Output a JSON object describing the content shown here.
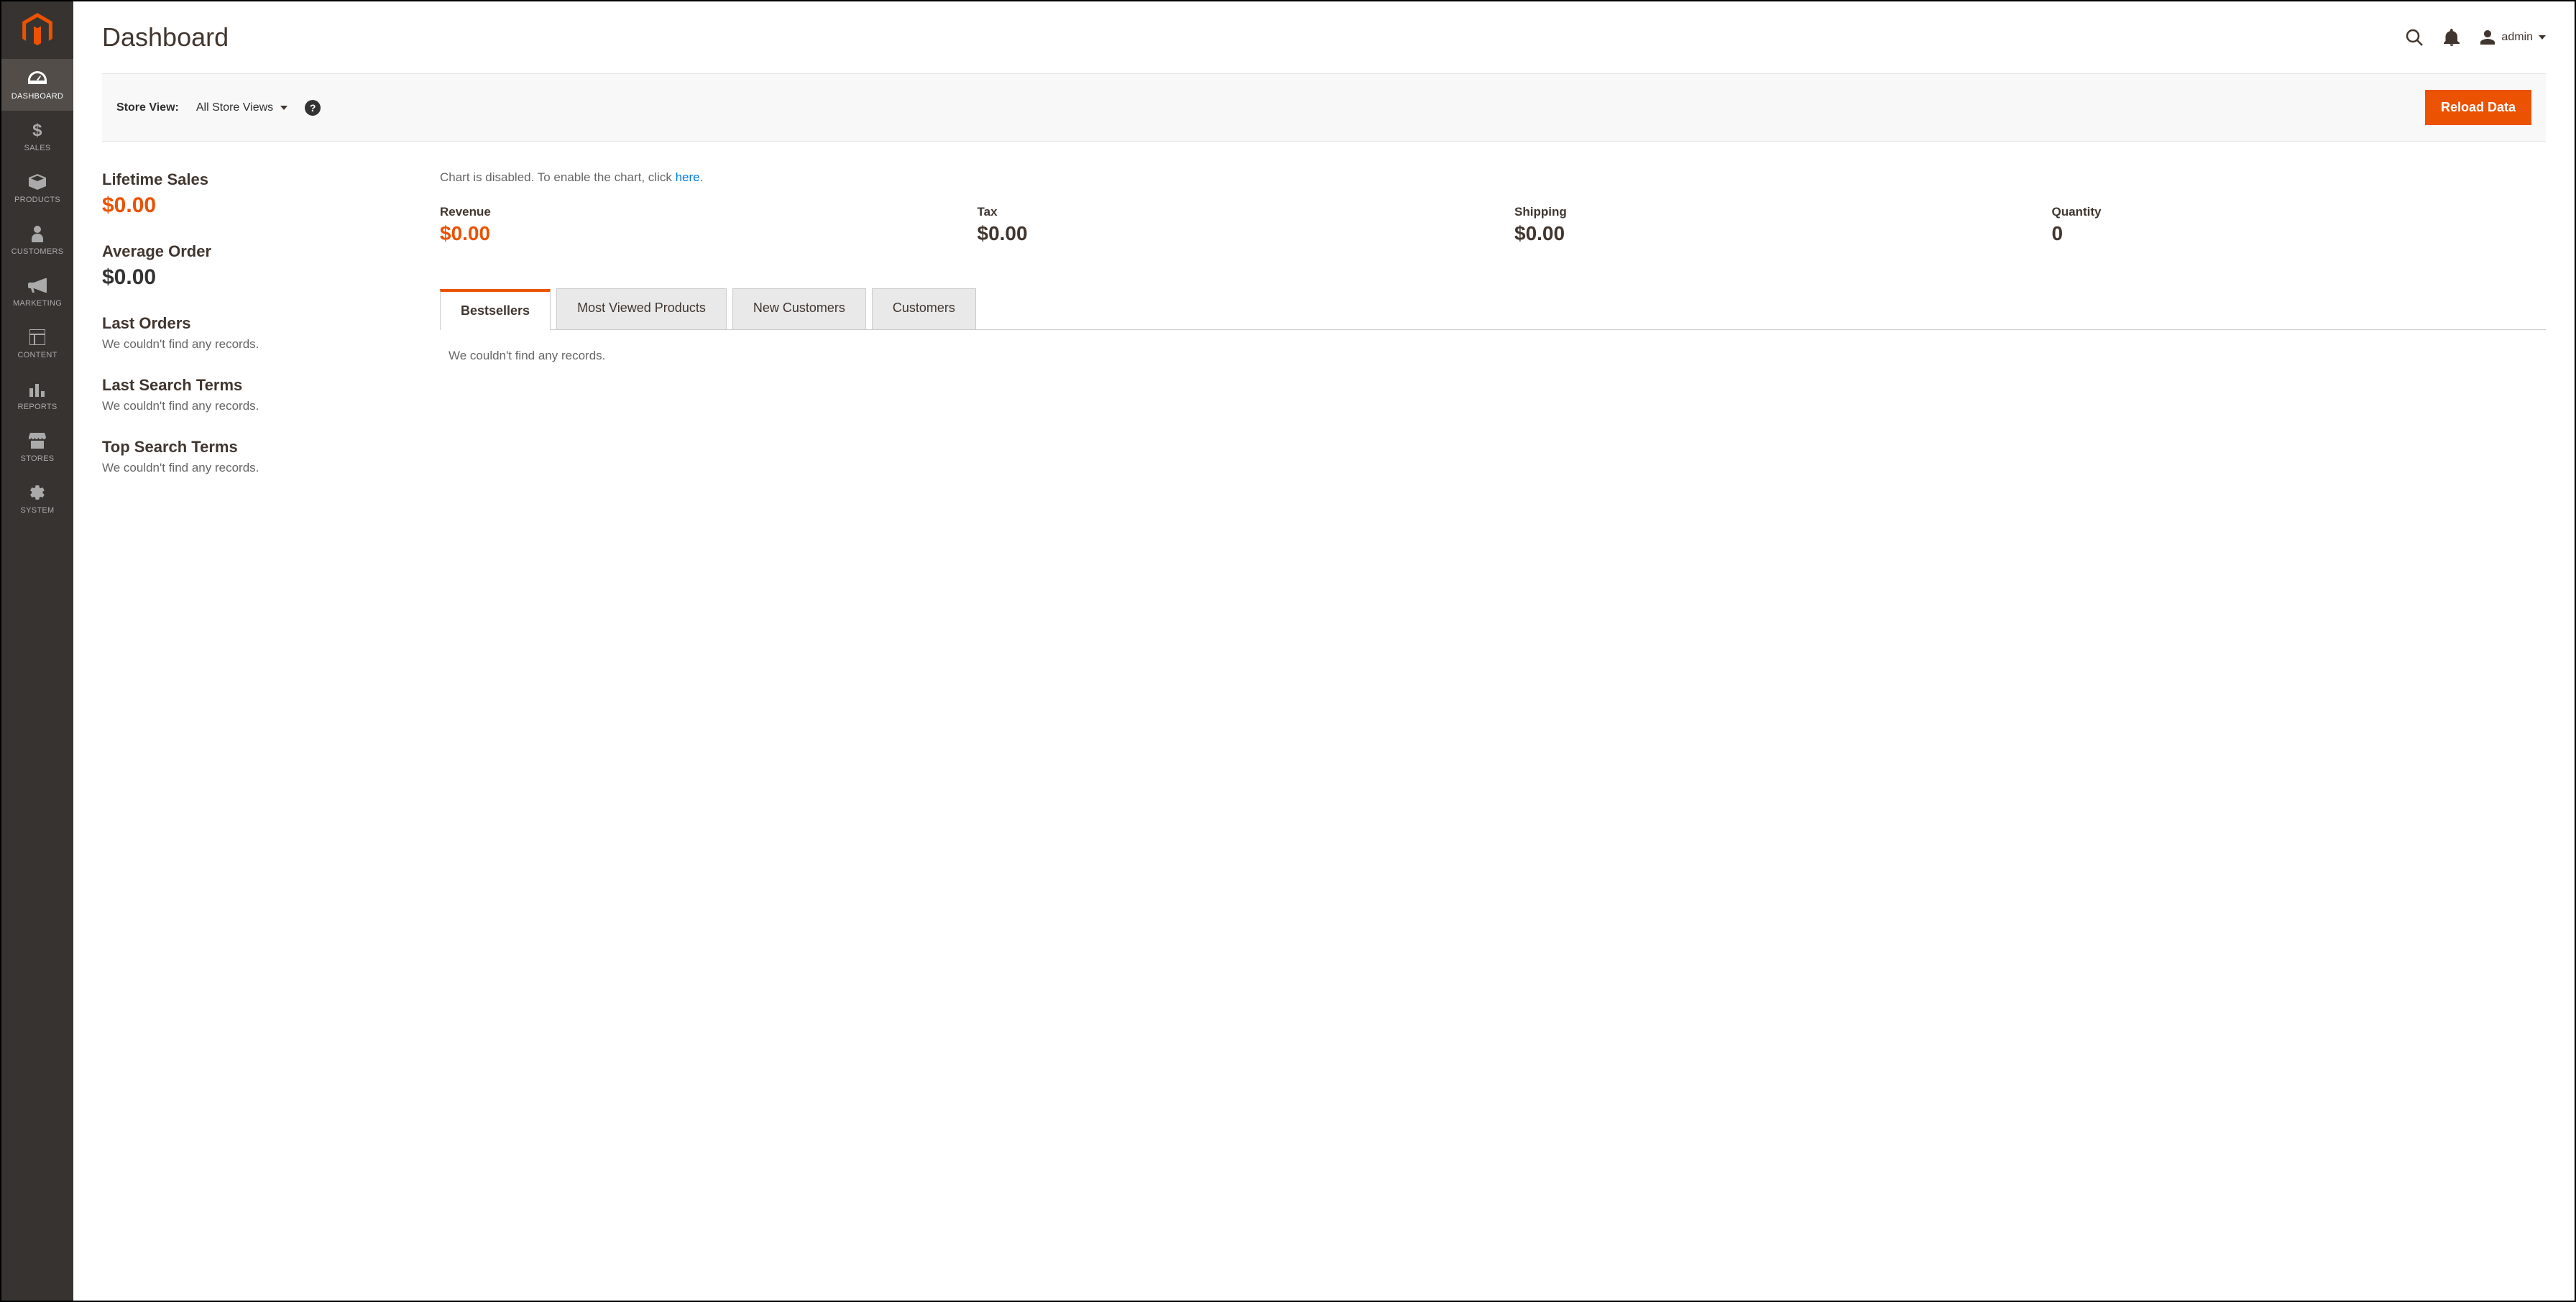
{
  "page_title": "Dashboard",
  "header": {
    "admin_label": "admin"
  },
  "sidebar": {
    "items": [
      {
        "label": "DASHBOARD"
      },
      {
        "label": "SALES"
      },
      {
        "label": "PRODUCTS"
      },
      {
        "label": "CUSTOMERS"
      },
      {
        "label": "MARKETING"
      },
      {
        "label": "CONTENT"
      },
      {
        "label": "REPORTS"
      },
      {
        "label": "STORES"
      },
      {
        "label": "SYSTEM"
      }
    ]
  },
  "storebar": {
    "label": "Store View:",
    "selected": "All Store Views",
    "reload_button": "Reload Data"
  },
  "left_blocks": {
    "lifetime_sales": {
      "title": "Lifetime Sales",
      "value": "$0.00"
    },
    "average_order": {
      "title": "Average Order",
      "value": "$0.00"
    },
    "last_orders": {
      "title": "Last Orders",
      "empty": "We couldn't find any records."
    },
    "last_search": {
      "title": "Last Search Terms",
      "empty": "We couldn't find any records."
    },
    "top_search": {
      "title": "Top Search Terms",
      "empty": "We couldn't find any records."
    }
  },
  "chart_msg": {
    "prefix": "Chart is disabled. To enable the chart, click ",
    "link": "here",
    "suffix": "."
  },
  "stats": [
    {
      "label": "Revenue",
      "value": "$0.00",
      "highlight": true
    },
    {
      "label": "Tax",
      "value": "$0.00"
    },
    {
      "label": "Shipping",
      "value": "$0.00"
    },
    {
      "label": "Quantity",
      "value": "0"
    }
  ],
  "tabs": [
    {
      "label": "Bestsellers",
      "active": true
    },
    {
      "label": "Most Viewed Products"
    },
    {
      "label": "New Customers"
    },
    {
      "label": "Customers"
    }
  ],
  "tab_empty": "We couldn't find any records."
}
